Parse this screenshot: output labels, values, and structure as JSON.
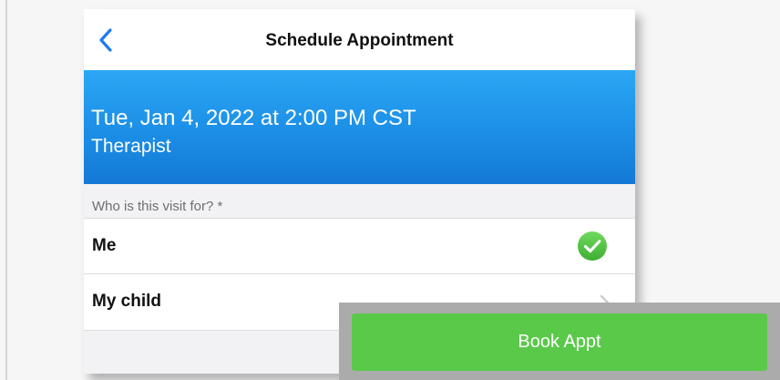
{
  "header": {
    "title": "Schedule Appointment",
    "back_icon": "chevron-left-icon"
  },
  "appointment": {
    "datetime": "Tue, Jan 4, 2022 at 2:00 PM CST",
    "provider_type": "Therapist"
  },
  "visit_for": {
    "label": "Who is this visit for? *",
    "options": [
      {
        "label": "Me",
        "selected": true,
        "icon": "checkmark-circle-icon"
      },
      {
        "label": "My child",
        "selected": false,
        "icon": "chevron-right-icon"
      }
    ]
  },
  "footer": {
    "book_label": "Book Appt"
  },
  "colors": {
    "accent_blue": "#1c8ee6",
    "success_green": "#5ac94a",
    "footer_gray": "#ababab"
  }
}
